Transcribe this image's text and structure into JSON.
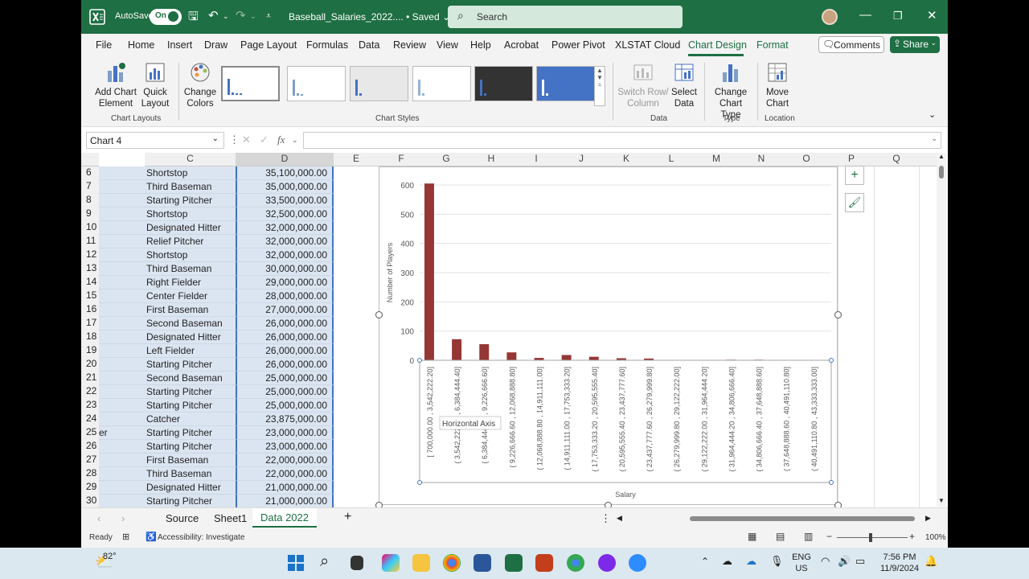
{
  "titlebar": {
    "autosave_label": "AutoSave",
    "autosave_state": "On",
    "file_title": "Baseball_Salaries_2022.... • Saved ⌄",
    "search_placeholder": "Search"
  },
  "menu": {
    "items": [
      "File",
      "Home",
      "Insert",
      "Draw",
      "Page Layout",
      "Formulas",
      "Data",
      "Review",
      "View",
      "Help",
      "Acrobat",
      "Power Pivot",
      "XLSTAT Cloud",
      "Chart Design",
      "Format"
    ],
    "active": "Chart Design",
    "comments_label": "Comments",
    "share_label": "Share"
  },
  "ribbon": {
    "add_chart_element": "Add Chart Element",
    "quick_layout": "Quick Layout",
    "change_colors": "Change Colors",
    "switch_row_column": "Switch Row/ Column",
    "select_data": "Select Data",
    "change_chart_type": "Change Chart Type",
    "move_chart": "Move Chart",
    "groups": {
      "chart_layouts": "Chart Layouts",
      "chart_styles": "Chart Styles",
      "data": "Data",
      "type": "Type",
      "location": "Location"
    }
  },
  "formula_bar": {
    "name_box": "Chart 4",
    "fx": "fx",
    "formula": ""
  },
  "columns": [
    "C",
    "D",
    "E",
    "F",
    "G",
    "H",
    "I",
    "J",
    "K",
    "L",
    "M",
    "N",
    "O",
    "P",
    "Q"
  ],
  "rows": [
    {
      "num": "6",
      "position": "Shortstop",
      "salary": "35,100,000.00"
    },
    {
      "num": "7",
      "position": "Third Baseman",
      "salary": "35,000,000.00"
    },
    {
      "num": "8",
      "position": "Starting Pitcher",
      "salary": "33,500,000.00"
    },
    {
      "num": "9",
      "position": "Shortstop",
      "salary": "32,500,000.00"
    },
    {
      "num": "10",
      "position": "Designated Hitter",
      "salary": "32,000,000.00"
    },
    {
      "num": "11",
      "position": "Relief Pitcher",
      "salary": "32,000,000.00"
    },
    {
      "num": "12",
      "position": "Shortstop",
      "salary": "32,000,000.00"
    },
    {
      "num": "13",
      "position": "Third Baseman",
      "salary": "30,000,000.00"
    },
    {
      "num": "14",
      "position": "Right Fielder",
      "salary": "29,000,000.00"
    },
    {
      "num": "15",
      "position": "Center Fielder",
      "salary": "28,000,000.00"
    },
    {
      "num": "16",
      "position": "First Baseman",
      "salary": "27,000,000.00"
    },
    {
      "num": "17",
      "position": "Second Baseman",
      "salary": "26,000,000.00"
    },
    {
      "num": "18",
      "position": "Designated Hitter",
      "salary": "26,000,000.00"
    },
    {
      "num": "19",
      "position": "Left Fielder",
      "salary": "26,000,000.00"
    },
    {
      "num": "20",
      "position": "Starting Pitcher",
      "salary": "26,000,000.00"
    },
    {
      "num": "21",
      "position": "Second Baseman",
      "salary": "25,000,000.00"
    },
    {
      "num": "22",
      "position": "Starting Pitcher",
      "salary": "25,000,000.00"
    },
    {
      "num": "23",
      "position": "Starting Pitcher",
      "salary": "25,000,000.00"
    },
    {
      "num": "24",
      "position": "Catcher",
      "salary": "23,875,000.00"
    },
    {
      "num": "25",
      "position": "Starting Pitcher",
      "salary": "23,000,000.00"
    },
    {
      "num": "26",
      "position": "Starting Pitcher",
      "salary": "23,000,000.00"
    },
    {
      "num": "27",
      "position": "First Baseman",
      "salary": "22,000,000.00"
    },
    {
      "num": "28",
      "position": "Third Baseman",
      "salary": "22,000,000.00"
    },
    {
      "num": "29",
      "position": "Designated Hitter",
      "salary": "21,000,000.00"
    },
    {
      "num": "30",
      "position": "Starting Pitcher",
      "salary": "21,000,000.00"
    }
  ],
  "row25_fragment": "er",
  "chart_data": {
    "type": "bar",
    "title": "",
    "xlabel": "Salary",
    "ylabel": "Number of Players",
    "ylim": [
      0,
      600
    ],
    "yticks": [
      0,
      100,
      200,
      300,
      400,
      500,
      600
    ],
    "grid": true,
    "color": "#953735",
    "categories": [
      "[ 700,000.00 , 3,542,222.20]",
      "( 3,542,222.20 , 6,384,444.40]",
      "( 6,384,444.40 , 9,226,666.60]",
      "( 9,226,666.60 , 12,068,888.80]",
      "( 12,068,888.80 , 14,911,111.00]",
      "( 14,911,111.00 , 17,753,333.20]",
      "( 17,753,333.20 , 20,595,555.40]",
      "( 20,595,555.40 , 23,437,777.60]",
      "( 23,437,777.60 , 26,279,999.80]",
      "( 26,279,999.80 , 29,122,222.00]",
      "( 29,122,222.00 , 31,964,444.20]",
      "( 31,964,444.20 , 34,806,666.40]",
      "( 34,806,666.40 , 37,648,888.60]",
      "( 37,648,888.60 , 40,491,110.80]",
      "( 40,491,110.80 , 43,333,333.00]"
    ],
    "values": [
      605,
      72,
      55,
      27,
      8,
      18,
      12,
      7,
      6,
      0,
      0,
      2,
      2,
      0,
      1
    ],
    "tooltip": "Horizontal Axis"
  },
  "sheets": {
    "tabs": [
      "Source",
      "Sheet1",
      "Data 2022"
    ],
    "active": "Data 2022"
  },
  "status": {
    "ready": "Ready",
    "accessibility": "Accessibility: Investigate",
    "zoom": "100%"
  },
  "taskbar": {
    "temperature": "82°",
    "lang_line1": "ENG",
    "lang_line2": "US",
    "time": "7:56 PM",
    "date": "11/9/2024"
  }
}
